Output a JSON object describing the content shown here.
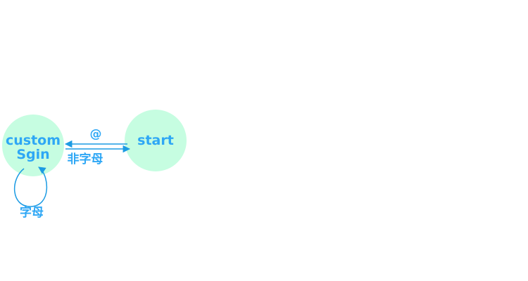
{
  "nodes": [
    {
      "id": "custom-sign",
      "lines": [
        "custom",
        "Sgin"
      ]
    },
    {
      "id": "start",
      "lines": [
        "start"
      ]
    }
  ],
  "edges": [
    {
      "from": "start",
      "to": "custom-sign",
      "label": "@"
    },
    {
      "from": "custom-sign",
      "to": "start",
      "label": "非字母"
    },
    {
      "from": "custom-sign",
      "to": "custom-sign",
      "label": "字母"
    }
  ],
  "colors": {
    "node_fill": "#c6fde1",
    "edge": "#1c9be3",
    "text": "#2ea7f5"
  }
}
